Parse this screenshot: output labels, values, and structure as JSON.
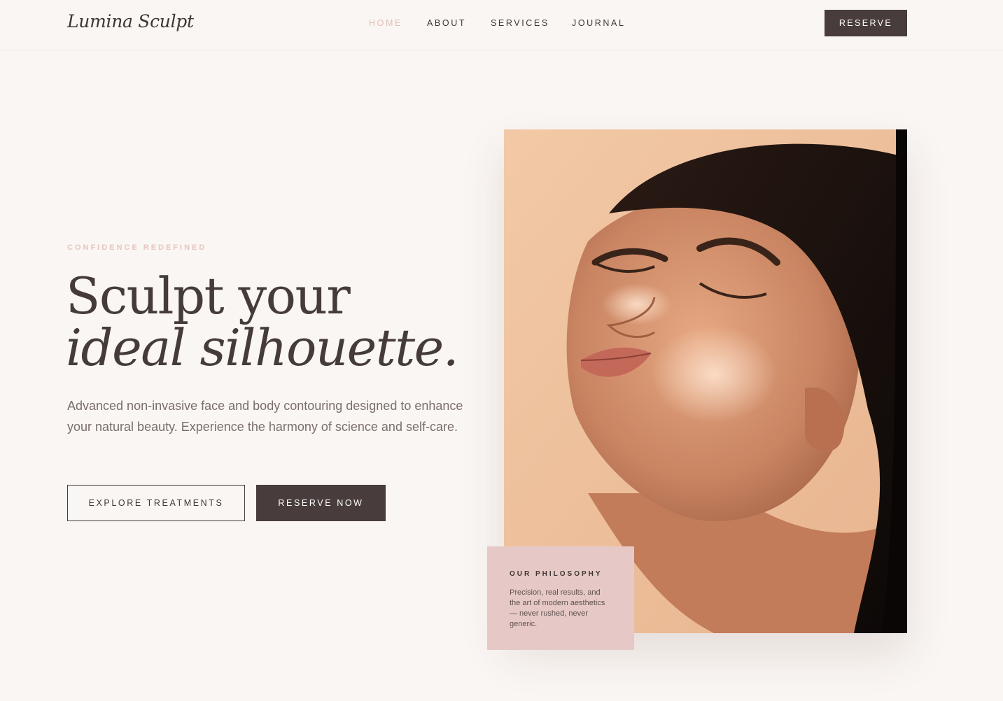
{
  "brand": {
    "logo": "Lumina Sculpt"
  },
  "nav": {
    "items": [
      {
        "label": "HOME",
        "active": true
      },
      {
        "label": "ABOUT",
        "active": false
      },
      {
        "label": "SERVICES",
        "active": false
      },
      {
        "label": "JOURNAL",
        "active": false
      }
    ],
    "cta_label": "RESERVE"
  },
  "hero": {
    "eyebrow": "CONFIDENCE REDEFINED",
    "headline_line1": "Sculpt your",
    "headline_line2": "ideal silhouette.",
    "lead": "Advanced non-invasive face and body contouring designed to enhance your natural beauty. Experience the harmony of science and self-care.",
    "primary_button": "EXPLORE TREATMENTS",
    "secondary_button": "RESERVE NOW"
  },
  "philosophy": {
    "title": "OUR PHILOSOPHY",
    "text": "Precision, real results, and the art of modern aesthetics — never rushed, never generic."
  },
  "colors": {
    "background": "#faf6f3",
    "text_dark": "#453b3b",
    "accent_pink": "#e1bdb9",
    "button_dark": "#483d3c",
    "card_pink": "#e6c9c6"
  }
}
